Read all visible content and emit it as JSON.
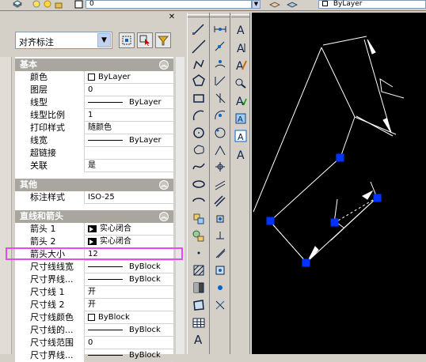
{
  "topbar": {
    "layer_value": "0",
    "color_value": "ByLayer"
  },
  "panel": {
    "close_icon": "close-icon",
    "dimension_dropdown": "对齐标注",
    "sections": {
      "basic": "基本",
      "other": "其他",
      "lines_arrows": "直线和箭头"
    },
    "basic_rows": [
      {
        "key": "颜色",
        "value": "ByLayer"
      },
      {
        "key": "图层",
        "value": "0"
      },
      {
        "key": "线型",
        "value": "ByLayer"
      },
      {
        "key": "线型比例",
        "value": "1"
      },
      {
        "key": "打印样式",
        "value": "随颜色"
      },
      {
        "key": "线宽",
        "value": "ByLayer"
      },
      {
        "key": "超链接",
        "value": ""
      },
      {
        "key": "关联",
        "value": "是"
      }
    ],
    "other_rows": [
      {
        "key": "标注样式",
        "value": "ISO-25"
      }
    ],
    "line_rows": [
      {
        "key": "箭头 1",
        "value": "实心闭合"
      },
      {
        "key": "箭头 2",
        "value": "实心闭合"
      },
      {
        "key": "箭头大小",
        "value": "12"
      },
      {
        "key": "尺寸线线宽",
        "value": "ByBlock"
      },
      {
        "key": "尺寸界线...",
        "value": "ByBlock"
      },
      {
        "key": "尺寸线 1",
        "value": "开"
      },
      {
        "key": "尺寸线 2",
        "value": "开"
      },
      {
        "key": "尺寸线颜色",
        "value": "ByBlock"
      },
      {
        "key": "尺寸线的...",
        "value": "ByBlock"
      },
      {
        "key": "尺寸线范围",
        "value": "0"
      },
      {
        "key": "尺寸界线...",
        "value": "ByBlock"
      }
    ]
  },
  "toolbar_draw": [
    "line-icon",
    "construction-line-icon",
    "polyline-icon",
    "polygon-icon",
    "rectangle-icon",
    "arc-icon",
    "circle-icon",
    "revision-cloud-icon",
    "spline-icon",
    "ellipse-icon",
    "ellipse-arc-icon",
    "insert-block-icon",
    "make-block-icon",
    "point-icon",
    "hatch-icon",
    "gradient-icon",
    "region-icon",
    "table-icon",
    "multiline-text-icon"
  ],
  "toolbar_dim": [
    "linear-dim-icon",
    "aligned-dim-icon",
    "arc-length-icon",
    "ordinate-icon",
    "radius-icon",
    "jogged-icon",
    "diameter-icon",
    "angular-icon",
    "quick-dim-icon",
    "baseline-icon",
    "continue-icon",
    "quick-leader-icon",
    "tolerance-icon",
    "center-mark-icon",
    "dim-edit-icon",
    "dim-text-edit-icon",
    "dim-update-icon"
  ],
  "toolbar_text": [
    "mtext-icon",
    "single-text-icon",
    "edit-text-icon",
    "find-icon",
    "spell-icon",
    "text-style-icon",
    "scale-text-icon",
    "justify-text-icon"
  ],
  "colors": {
    "canvas": "#000000",
    "grip": "#0033ff",
    "highlight": "#e44cee"
  }
}
